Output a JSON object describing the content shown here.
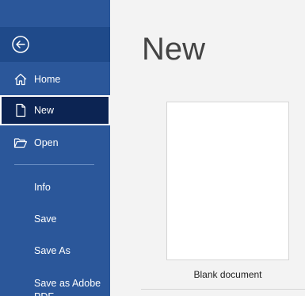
{
  "sidebar": {
    "back_icon": "back-arrow-circle-icon",
    "items": [
      {
        "label": "Home",
        "icon": "home-icon"
      },
      {
        "label": "New",
        "icon": "new-document-icon"
      },
      {
        "label": "Open",
        "icon": "folder-open-icon"
      }
    ],
    "text_items": [
      "Info",
      "Save",
      "Save As",
      "Save as Adobe PDF"
    ]
  },
  "main": {
    "title": "New",
    "templates": [
      {
        "label": "Blank document"
      }
    ]
  },
  "colors": {
    "sidebar": "#2b579a",
    "selected": "#0c2453",
    "background": "#f3f3f3"
  }
}
